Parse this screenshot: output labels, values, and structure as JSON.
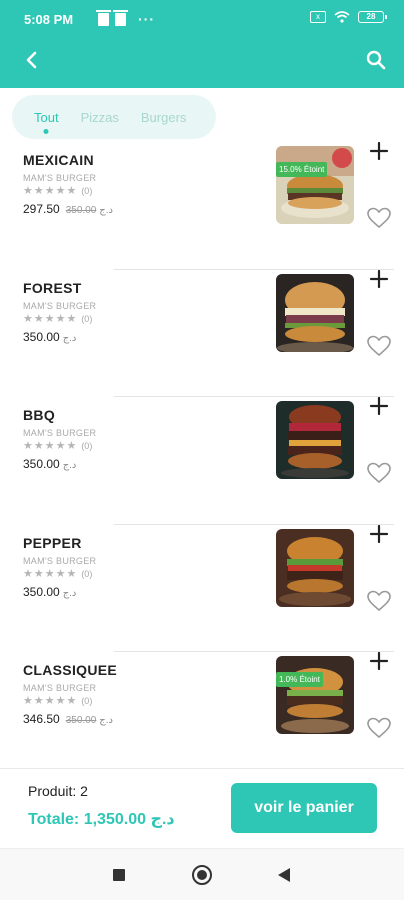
{
  "status": {
    "time": "5:08 PM",
    "sim": "x",
    "battery": "28"
  },
  "appbar": {
    "back_icon": "chevron-left-icon",
    "search_icon": "search-icon"
  },
  "tabs": [
    {
      "label": "Tout",
      "active": true
    },
    {
      "label": "Pizzas",
      "active": false
    },
    {
      "label": "Burgers",
      "active": false
    }
  ],
  "products": [
    {
      "name": "MEXICAIN",
      "brand": "MAM'S BURGER",
      "rating": "★★★★★",
      "reviews": "(0)",
      "price": "297.50",
      "currency": "د.ج",
      "old_price": "350.00",
      "discount": "15.0% Étoint"
    },
    {
      "name": "FOREST",
      "brand": "MAM'S BURGER",
      "rating": "★★★★★",
      "reviews": "(0)",
      "price": "350.00",
      "currency": "د.ج"
    },
    {
      "name": "BBQ",
      "brand": "MAM'S BURGER",
      "rating": "★★★★★",
      "reviews": "(0)",
      "price": "350.00",
      "currency": "د.ج"
    },
    {
      "name": "PEPPER",
      "brand": "MAM'S BURGER",
      "rating": "★★★★★",
      "reviews": "(0)",
      "price": "350.00",
      "currency": "د.ج"
    },
    {
      "name": "CLASSIQUEE",
      "brand": "MAM'S BURGER",
      "rating": "★★★★★",
      "reviews": "(0)",
      "price": "346.50",
      "currency": "د.ج",
      "old_price": "350.00",
      "discount": "1.0% Étoint"
    }
  ],
  "cart": {
    "quantity_label": "Produit: 2",
    "total_label": "Totale: 1,350.00 د.ج",
    "button_label": "voir le panier"
  },
  "colors": {
    "accent": "#2ec7b5",
    "discount_badge": "#44b858"
  }
}
